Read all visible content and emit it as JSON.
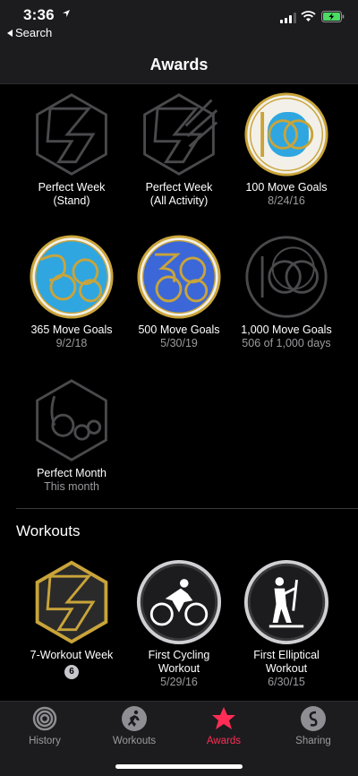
{
  "status": {
    "time": "3:36",
    "back_label": "Search"
  },
  "nav": {
    "title": "Awards"
  },
  "awards": [
    {
      "name": "Perfect Week\n(Stand)",
      "sub": ""
    },
    {
      "name": "Perfect Week\n(All Activity)",
      "sub": ""
    },
    {
      "name": "100 Move Goals",
      "sub": "8/24/16"
    },
    {
      "name": "365 Move Goals",
      "sub": "9/2/18"
    },
    {
      "name": "500 Move Goals",
      "sub": "5/30/19"
    },
    {
      "name": "1,000 Move Goals",
      "sub": "506 of 1,000 days"
    },
    {
      "name": "Perfect Month",
      "sub": "This month"
    }
  ],
  "workouts_section": {
    "title": "Workouts",
    "items": [
      {
        "name": "7-Workout Week",
        "count": "6"
      },
      {
        "name": "First Cycling\nWorkout",
        "sub": "5/29/16"
      },
      {
        "name": "First Elliptical\nWorkout",
        "sub": "6/30/15"
      }
    ]
  },
  "tabs": [
    {
      "label": "History"
    },
    {
      "label": "Workouts"
    },
    {
      "label": "Awards"
    },
    {
      "label": "Sharing"
    }
  ],
  "colors": {
    "accent": "#ff2d55",
    "gold": "#c9a43a",
    "blue": "#2fa6e0",
    "battery": "#4cd964"
  }
}
